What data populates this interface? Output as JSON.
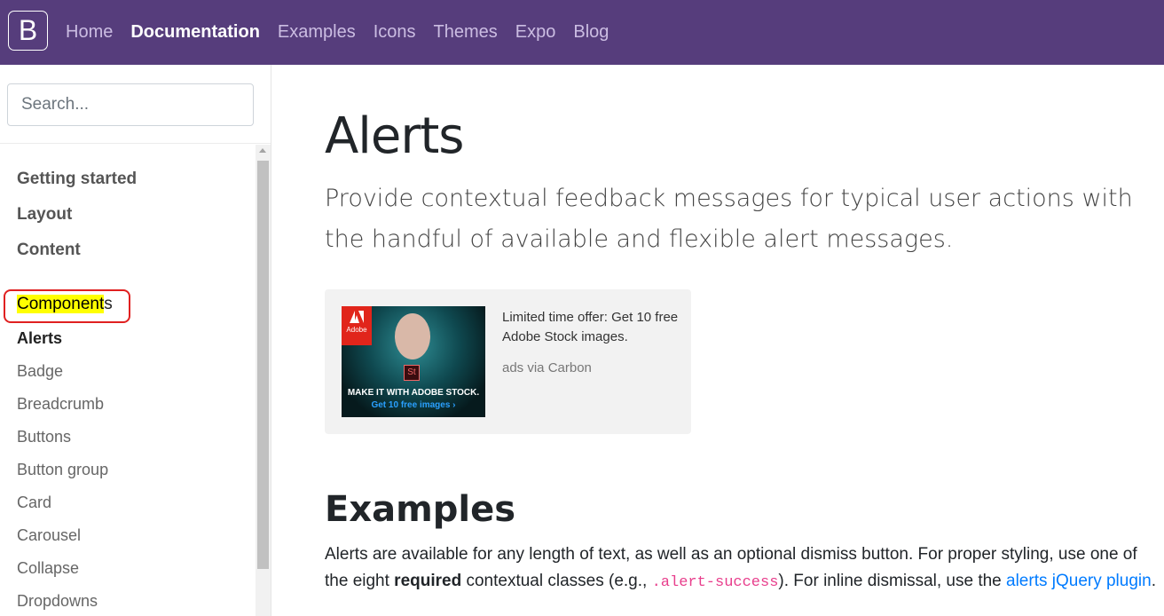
{
  "navbar": {
    "brand": "B",
    "links": [
      "Home",
      "Documentation",
      "Examples",
      "Icons",
      "Themes",
      "Expo",
      "Blog"
    ]
  },
  "sidebar": {
    "search_placeholder": "Search...",
    "sections": [
      "Getting started",
      "Layout",
      "Content"
    ],
    "components_label_highlighted": "Component",
    "components_label_rest": "s",
    "items": [
      "Alerts",
      "Badge",
      "Breadcrumb",
      "Buttons",
      "Button group",
      "Card",
      "Carousel",
      "Collapse",
      "Dropdowns"
    ]
  },
  "main": {
    "title": "Alerts",
    "lead": "Provide contextual feedback messages for typical user actions with the handful of available and flexible alert messages.",
    "ad": {
      "text": "Limited time offer: Get 10 free Adobe Stock images.",
      "via": "ads via Carbon",
      "badge": "Adobe",
      "mark": "St",
      "line1": "MAKE IT WITH ADOBE STOCK.",
      "line2": "Get 10 free images ›"
    },
    "section_title": "Examples",
    "para": {
      "p1": "Alerts are available for any length of text, as well as an optional dismiss button. For proper styling, use one of the eight ",
      "bold": "required",
      "p2": " contextual classes (e.g., ",
      "code": ".alert-success",
      "p3": "). For inline dismissal, use the ",
      "link": "alerts jQuery plugin",
      "p4": "."
    }
  },
  "colors": {
    "navbar_bg": "#563d7c",
    "link": "#007bff",
    "code": "#e83e8c",
    "highlight": "#ffff00",
    "annotation": "#e02020"
  }
}
